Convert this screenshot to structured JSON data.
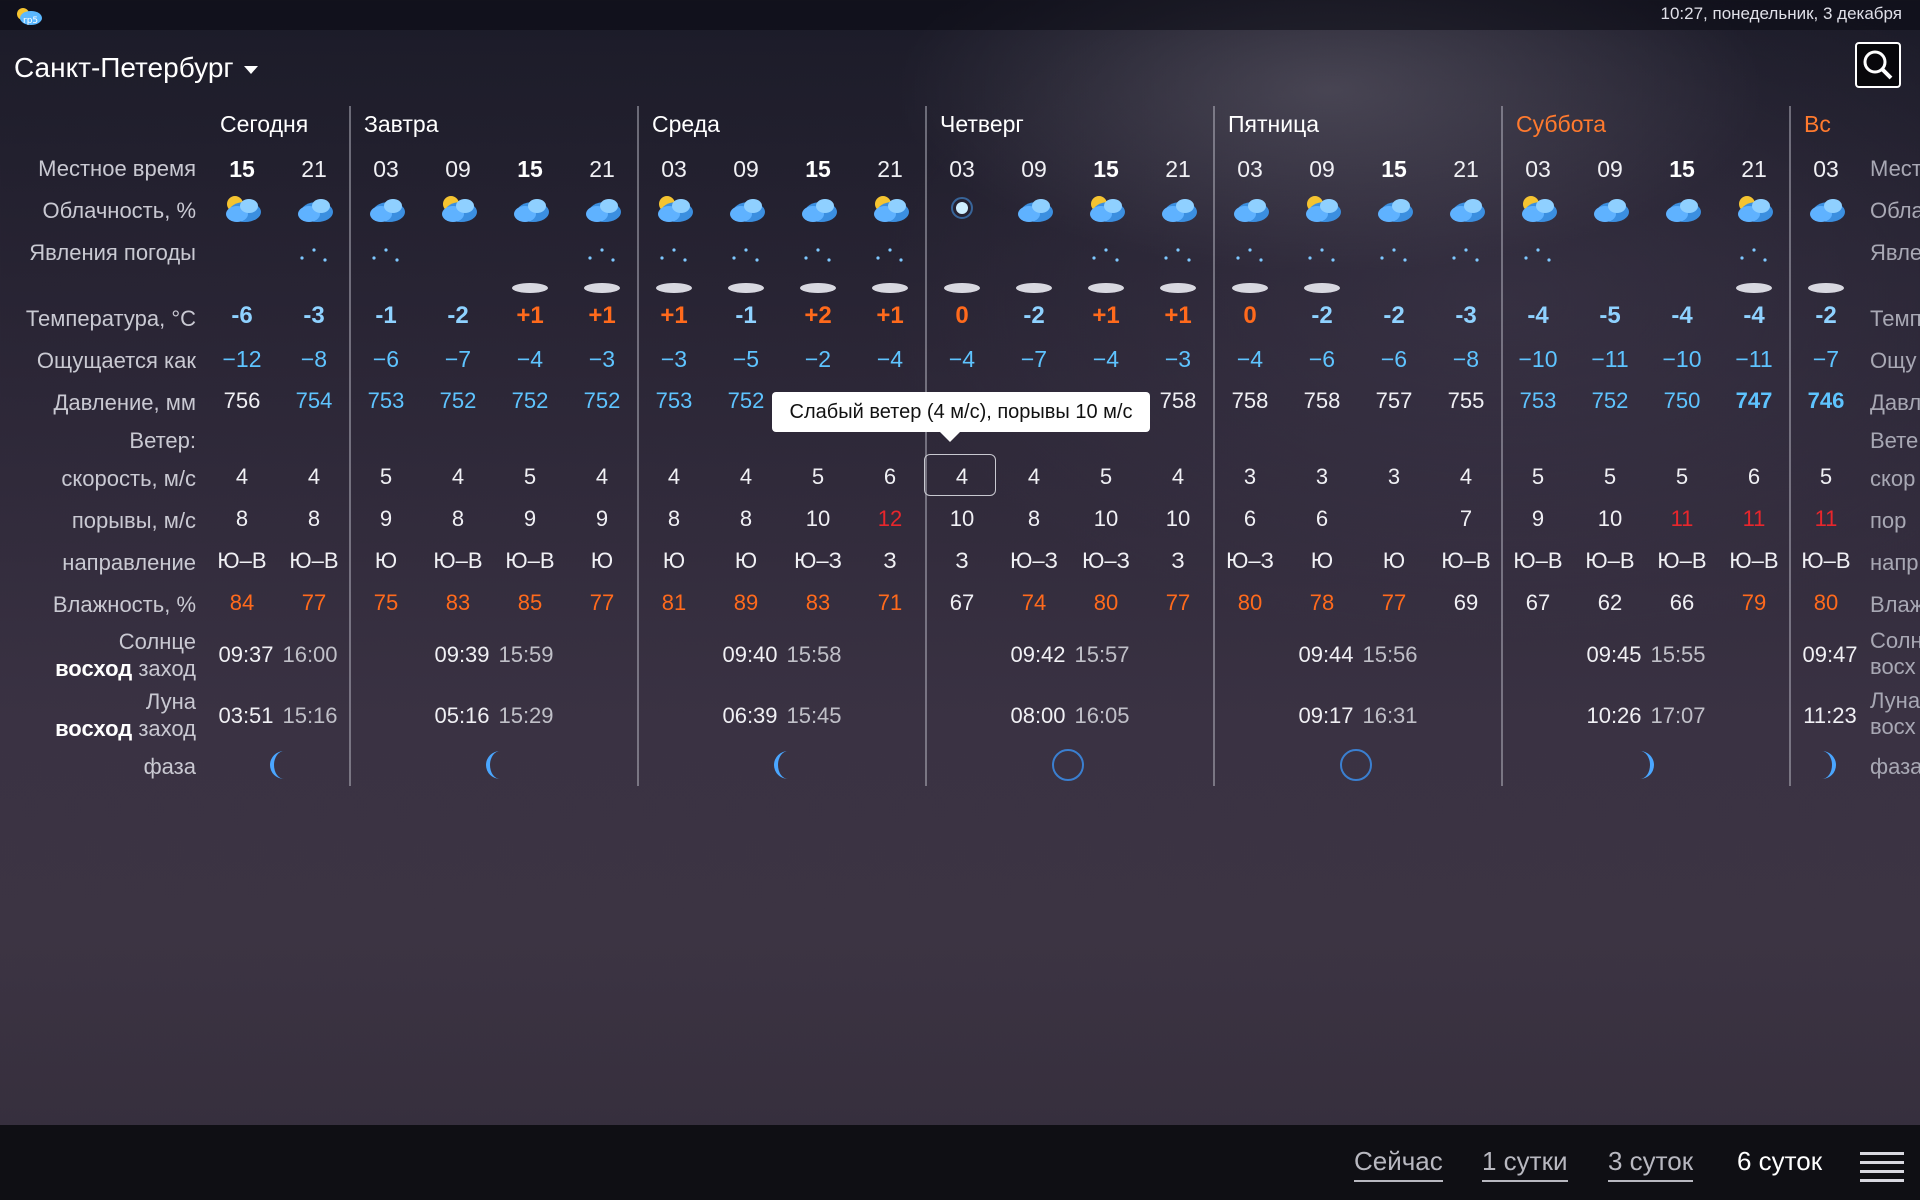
{
  "status": {
    "clock": "10:27, понедельник, 3 декабря",
    "app_badge": "rp5"
  },
  "city": {
    "name": "Санкт-Петербург"
  },
  "labels": {
    "local_time": "Местное время",
    "cloudiness": "Облачность, %",
    "phenomena": "Явления погоды",
    "temperature": "Температура, °C",
    "feels_like": "Ощущается как",
    "pressure": "Давление, мм",
    "wind": "Ветер:",
    "wind_speed": "скорость, м/с",
    "wind_gusts": "порывы, м/с",
    "wind_direction": "направление",
    "humidity": "Влажность, %",
    "sun": "Солнце",
    "moon": "Луна",
    "rise": "восход",
    "set": "заход",
    "phase": "фаза"
  },
  "right_labels": [
    "Мест",
    "Обла",
    "Явле",
    "Темп",
    "Ощу",
    "Давл",
    "Вете",
    "скор",
    "пор",
    "напр",
    "Влаж",
    "Солн",
    "восх",
    "Луна",
    "восх",
    "фаза"
  ],
  "days": [
    "Сегодня",
    "Завтра",
    "Среда",
    "Четверг",
    "Пятница",
    "Суббота",
    "Вс"
  ],
  "hours": [
    "15",
    "21",
    "03",
    "09",
    "15",
    "21",
    "03",
    "09",
    "15",
    "21",
    "03",
    "09",
    "15",
    "21",
    "03",
    "09",
    "15",
    "21",
    "03",
    "09",
    "15",
    "21",
    "03"
  ],
  "temperatures": [
    "-6",
    "-3",
    "-1",
    "-2",
    "+1",
    "+1",
    "+1",
    "-1",
    "+2",
    "+1",
    "0",
    "-2",
    "+1",
    "+1",
    "0",
    "-2",
    "-2",
    "-3",
    "-4",
    "-5",
    "-4",
    "-4",
    "-2"
  ],
  "feels_like": [
    "−12",
    "−8",
    "−6",
    "−7",
    "−4",
    "−3",
    "−3",
    "−5",
    "−2",
    "−4",
    "−4",
    "−7",
    "−4",
    "−3",
    "−4",
    "−6",
    "−6",
    "−8",
    "−10",
    "−11",
    "−10",
    "−11",
    "−7"
  ],
  "pressure": [
    "756",
    "754",
    "753",
    "752",
    "752",
    "752",
    "753",
    "752",
    "",
    "",
    "",
    "",
    "",
    "758",
    "758",
    "758",
    "757",
    "755",
    "753",
    "752",
    "750",
    "747",
    "746"
  ],
  "wind_speed": [
    "4",
    "4",
    "5",
    "4",
    "5",
    "4",
    "4",
    "4",
    "5",
    "6",
    "4",
    "4",
    "5",
    "4",
    "3",
    "3",
    "3",
    "4",
    "5",
    "5",
    "5",
    "6",
    "5"
  ],
  "wind_gusts": [
    "8",
    "8",
    "9",
    "8",
    "9",
    "9",
    "8",
    "8",
    "10",
    "12",
    "10",
    "8",
    "10",
    "10",
    "6",
    "6",
    "",
    "7",
    "9",
    "10",
    "11",
    "11",
    "11"
  ],
  "wind_direction": [
    "Ю–В",
    "Ю–В",
    "Ю",
    "Ю–В",
    "Ю–В",
    "Ю",
    "Ю",
    "Ю",
    "Ю–З",
    "З",
    "З",
    "Ю–З",
    "Ю–З",
    "З",
    "Ю–З",
    "Ю",
    "Ю",
    "Ю–В",
    "Ю–В",
    "Ю–В",
    "Ю–В",
    "Ю–В",
    "Ю–В"
  ],
  "humidity": [
    "84",
    "77",
    "75",
    "83",
    "85",
    "77",
    "81",
    "89",
    "83",
    "71",
    "67",
    "74",
    "80",
    "77",
    "80",
    "78",
    "77",
    "69",
    "67",
    "62",
    "66",
    "79",
    "80"
  ],
  "sun": [
    {
      "rise": "09:37",
      "set": "16:00"
    },
    {
      "rise": "09:39",
      "set": "15:59"
    },
    {
      "rise": "09:40",
      "set": "15:58"
    },
    {
      "rise": "09:42",
      "set": "15:57"
    },
    {
      "rise": "09:44",
      "set": "15:56"
    },
    {
      "rise": "09:45",
      "set": "15:55"
    },
    {
      "rise": "09:47",
      "set": ""
    }
  ],
  "moon": [
    {
      "rise": "03:51",
      "set": "15:16"
    },
    {
      "rise": "05:16",
      "set": "15:29"
    },
    {
      "rise": "06:39",
      "set": "15:45"
    },
    {
      "rise": "08:00",
      "set": "16:05"
    },
    {
      "rise": "09:17",
      "set": "16:31"
    },
    {
      "rise": "10:26",
      "set": "17:07"
    },
    {
      "rise": "11:23",
      "set": ""
    }
  ],
  "tooltip": "Слабый ветер (4 м/с), порывы 10 м/с",
  "tabs": {
    "now": "Сейчас",
    "one_day": "1 сутки",
    "three_days": "3 суток",
    "six_days": "6 суток"
  },
  "colors": {
    "cold": "#8fd2ff",
    "warm": "#ff6a1c",
    "pressure_low": "#5ec4ff",
    "gust_strong": "#e8262c",
    "weekend": "#ff7a2e"
  }
}
